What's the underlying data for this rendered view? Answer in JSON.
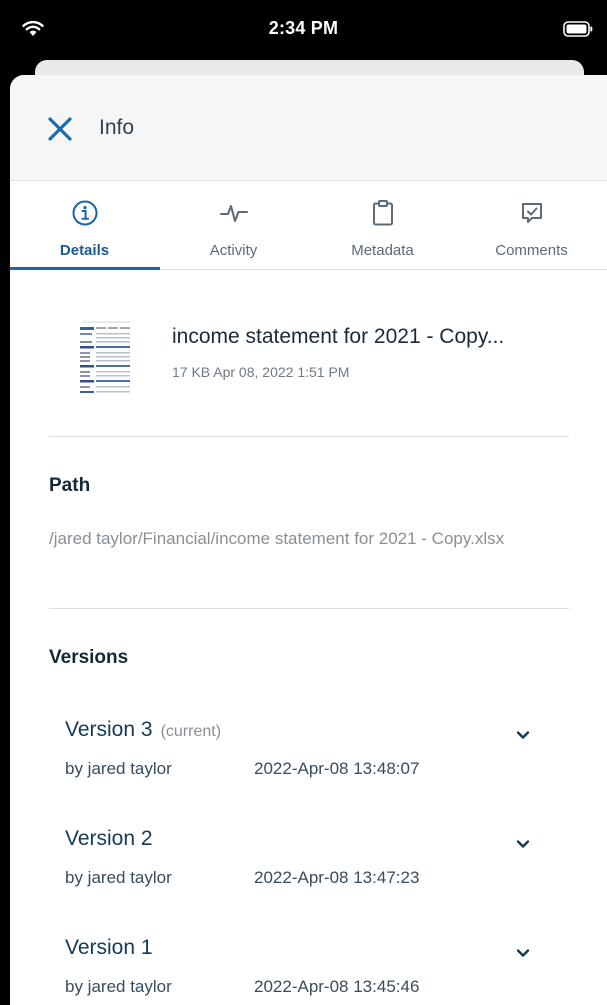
{
  "status_bar": {
    "time": "2:34 PM"
  },
  "header": {
    "title": "Info"
  },
  "tabs": [
    {
      "label": "Details",
      "icon": "info-icon",
      "active": true
    },
    {
      "label": "Activity",
      "icon": "activity-icon",
      "active": false
    },
    {
      "label": "Metadata",
      "icon": "clipboard-icon",
      "active": false
    },
    {
      "label": "Comments",
      "icon": "comment-icon",
      "active": false
    }
  ],
  "file": {
    "name": "income statement for 2021 - Copy...",
    "meta": "17 KB Apr 08, 2022 1:51 PM"
  },
  "path": {
    "title": "Path",
    "value": "/jared taylor/Financial/income statement for 2021 - Copy.xlsx"
  },
  "versions": {
    "title": "Versions",
    "items": [
      {
        "name": "Version 3",
        "tag": "(current)",
        "by": "by jared taylor",
        "date": "2022-Apr-08 13:48:07"
      },
      {
        "name": "Version 2",
        "tag": "",
        "by": "by jared taylor",
        "date": "2022-Apr-08 13:47:23"
      },
      {
        "name": "Version 1",
        "tag": "",
        "by": "by jared taylor",
        "date": "2022-Apr-08 13:45:46"
      }
    ]
  },
  "colors": {
    "accent": "#1a64a8",
    "close": "#1b6bb3",
    "text_dark": "#142838",
    "muted": "#8a8f94"
  }
}
